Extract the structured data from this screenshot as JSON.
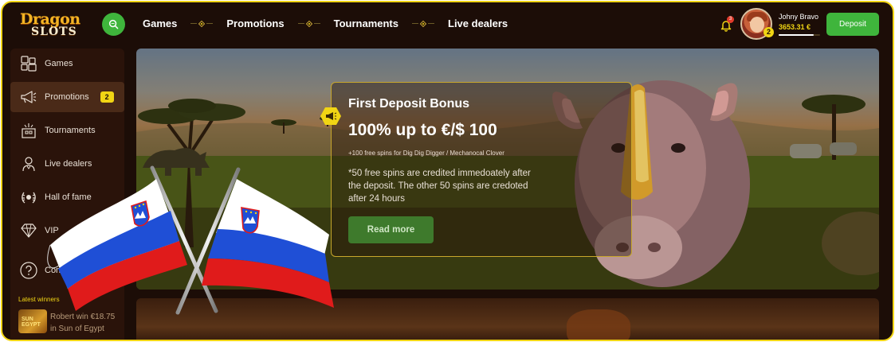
{
  "brand": {
    "line1": "Dragon",
    "line2": "SLOTS"
  },
  "nav": [
    {
      "label": "Games"
    },
    {
      "label": "Promotions"
    },
    {
      "label": "Tournaments"
    },
    {
      "label": "Live dealers"
    }
  ],
  "notifications": {
    "count": "3"
  },
  "user": {
    "name": "Johny Bravo",
    "balance": "3653.31 €",
    "level": "2",
    "progress": 0.85
  },
  "deposit_label": "Deposit",
  "sidebar": {
    "items": [
      {
        "label": "Games",
        "icon": "games-icon"
      },
      {
        "label": "Promotions",
        "icon": "megaphone-icon",
        "badge": "2"
      },
      {
        "label": "Tournaments",
        "icon": "tournaments-icon"
      },
      {
        "label": "Live dealers",
        "icon": "dealer-icon"
      },
      {
        "label": "Hall of fame",
        "icon": "laurel-icon"
      },
      {
        "label": "VIP",
        "icon": "diamond-icon"
      },
      {
        "label": "Contacts",
        "icon": "help-icon"
      }
    ],
    "latest_winners_label": "Latest winners",
    "winner": {
      "thumb_text": "SUN EGYPT",
      "line1": "Robert win €18.75",
      "line2": "in Sun of Egypt"
    }
  },
  "promo": {
    "title": "First Deposit Bonus",
    "headline": "100% up to €/$ 100",
    "subtitle": "+100 free spins for Dig Dig Digger / Mechanocal Clover",
    "description": "*50 free spins are credited immedoately after the deposit. The other 50 spins are credoted after 24 hours",
    "button_label": "Read more"
  },
  "colors": {
    "accent_yellow": "#f1d514",
    "button_green": "#3fb53c",
    "background": "#1c0d07",
    "flag_white": "#ffffff",
    "flag_blue": "#1f4fd6",
    "flag_red": "#e01b1b"
  }
}
